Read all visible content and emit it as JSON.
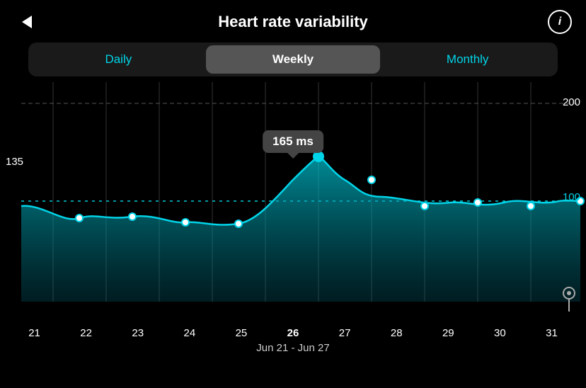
{
  "header": {
    "title": "Heart rate variability",
    "back_label": "back",
    "info_label": "i"
  },
  "tabs": {
    "daily": "Daily",
    "weekly": "Weekly",
    "monthly": "Monthly",
    "active": "weekly"
  },
  "chart": {
    "tooltip_value": "165 ms",
    "y_labels": {
      "top": "200",
      "mid": "135",
      "bottom_cyan": "100"
    },
    "x_labels": [
      "21",
      "22",
      "23",
      "24",
      "25",
      "26",
      "27",
      "28",
      "29",
      "30",
      "31"
    ],
    "active_x": "26",
    "date_range": "Jun 21 - Jun 27"
  },
  "icons": {
    "back": "‹",
    "info": "i",
    "bottom": "♡"
  }
}
